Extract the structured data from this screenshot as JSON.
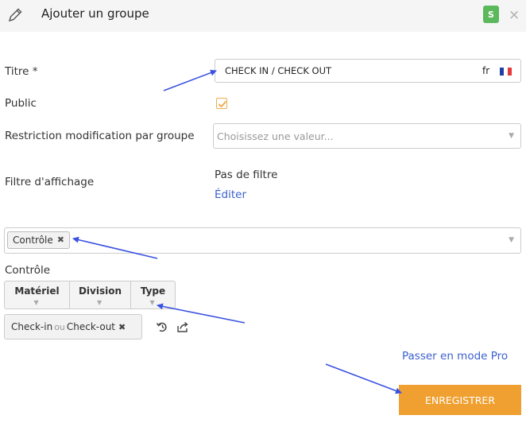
{
  "header": {
    "title": "Ajouter un groupe",
    "badge": "S",
    "close": "×"
  },
  "form": {
    "titre_label": "Titre *",
    "titre_value": "CHECK IN / CHECK OUT",
    "lang_code": "fr",
    "public_label": "Public",
    "public_checked": true,
    "restriction_label": "Restriction modification par groupe",
    "restriction_placeholder": "Choisissez une valeur...",
    "filtre_label": "Filtre d'affichage",
    "filtre_value": "Pas de filtre",
    "editer_link": "Éditer",
    "selected_tag": "Contrôle",
    "section_label": "Contrôle",
    "columns": [
      "Matériel",
      "Division",
      "Type"
    ],
    "filter_chip": {
      "left": "Check-in",
      "joiner": "ou",
      "right": "Check-out"
    },
    "pro_link": "Passer en mode Pro",
    "save_button": "ENREGISTRER"
  },
  "colors": {
    "accent_orange": "#f0a030",
    "link_blue": "#3a5fcd",
    "badge_green": "#5cb85c",
    "annotation_arrow": "#3b52e0"
  },
  "icons": [
    "pencil-icon",
    "close-icon",
    "france-flag-icon",
    "checkmark-icon",
    "chevron-down-icon",
    "undo-icon",
    "share-icon"
  ]
}
